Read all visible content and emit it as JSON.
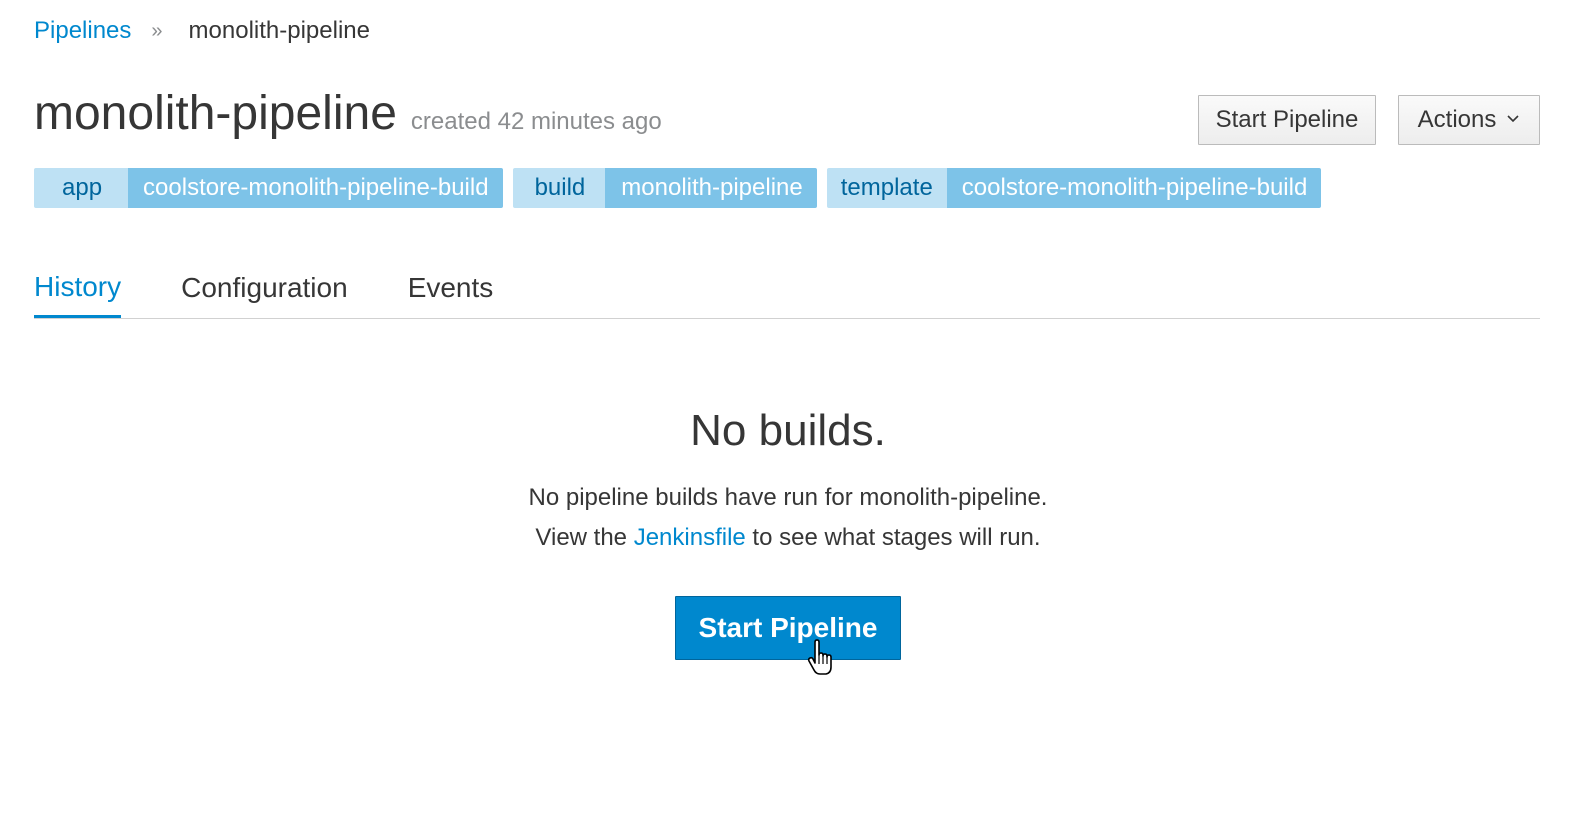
{
  "breadcrumb": {
    "parent": "Pipelines",
    "separator": "»",
    "current": "monolith-pipeline"
  },
  "header": {
    "title": "monolith-pipeline",
    "subtitle": "created 42 minutes ago",
    "start_button": "Start Pipeline",
    "actions_button": "Actions",
    "actions_icon": "chevron-down-icon"
  },
  "labels": [
    {
      "key": "app",
      "value": "coolstore-monolith-pipeline-build"
    },
    {
      "key": "build",
      "value": "monolith-pipeline"
    },
    {
      "key": "template",
      "value": "coolstore-monolith-pipeline-build"
    }
  ],
  "tabs": [
    {
      "label": "History",
      "active": true
    },
    {
      "label": "Configuration",
      "active": false
    },
    {
      "label": "Events",
      "active": false
    }
  ],
  "empty_state": {
    "title": "No builds.",
    "line1": "No pipeline builds have run for monolith-pipeline.",
    "line2_prefix": "View the ",
    "line2_link": "Jenkinsfile",
    "line2_suffix": " to see what stages will run.",
    "button": "Start Pipeline"
  },
  "colors": {
    "primary": "#0088ce",
    "label_key_bg": "#bee1f4",
    "label_value_bg": "#7dc3e8"
  }
}
